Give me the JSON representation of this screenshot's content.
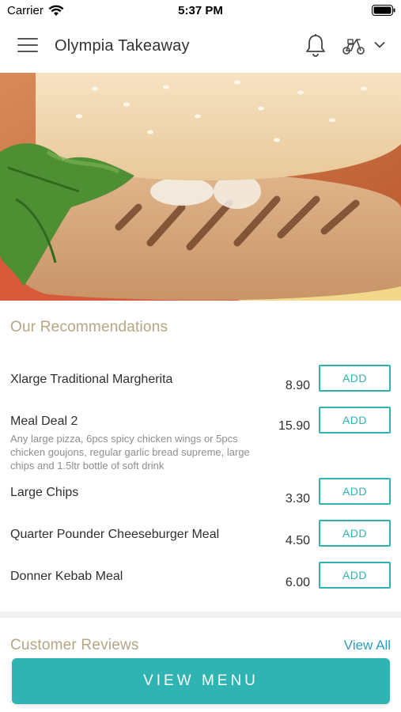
{
  "status_bar": {
    "carrier": "Carrier",
    "time": "5:37 PM"
  },
  "header": {
    "title": "Olympia Takeaway",
    "icons": [
      "menu-icon",
      "bell-icon",
      "scooter-icon",
      "chevron-down-icon"
    ]
  },
  "hero": {
    "image": "burger-photo"
  },
  "recommendations": {
    "title": "Our Recommendations",
    "items": [
      {
        "name": "Xlarge Traditional Margherita",
        "description": "",
        "price": "8.90",
        "button": "ADD"
      },
      {
        "name": "Meal Deal 2",
        "description": "Any large pizza, 6pcs spicy chicken wings or 5pcs chicken goujons, regular garlic bread supreme, large chips and 1.5ltr bottle of soft drink",
        "price": "15.90",
        "button": "ADD"
      },
      {
        "name": "Large Chips",
        "description": "",
        "price": "3.30",
        "button": "ADD"
      },
      {
        "name": "Quarter Pounder Cheeseburger Meal",
        "description": "",
        "price": "4.50",
        "button": "ADD"
      },
      {
        "name": "Donner Kebab Meal",
        "description": "",
        "price": "6.00",
        "button": "ADD"
      }
    ]
  },
  "reviews": {
    "title": "Customer Reviews",
    "view_all": "View All"
  },
  "footer": {
    "view_menu": "VIEW MENU"
  },
  "colors": {
    "accent": "#2fb3b3",
    "section_title": "#b5a583",
    "link": "#2a9fc1"
  }
}
